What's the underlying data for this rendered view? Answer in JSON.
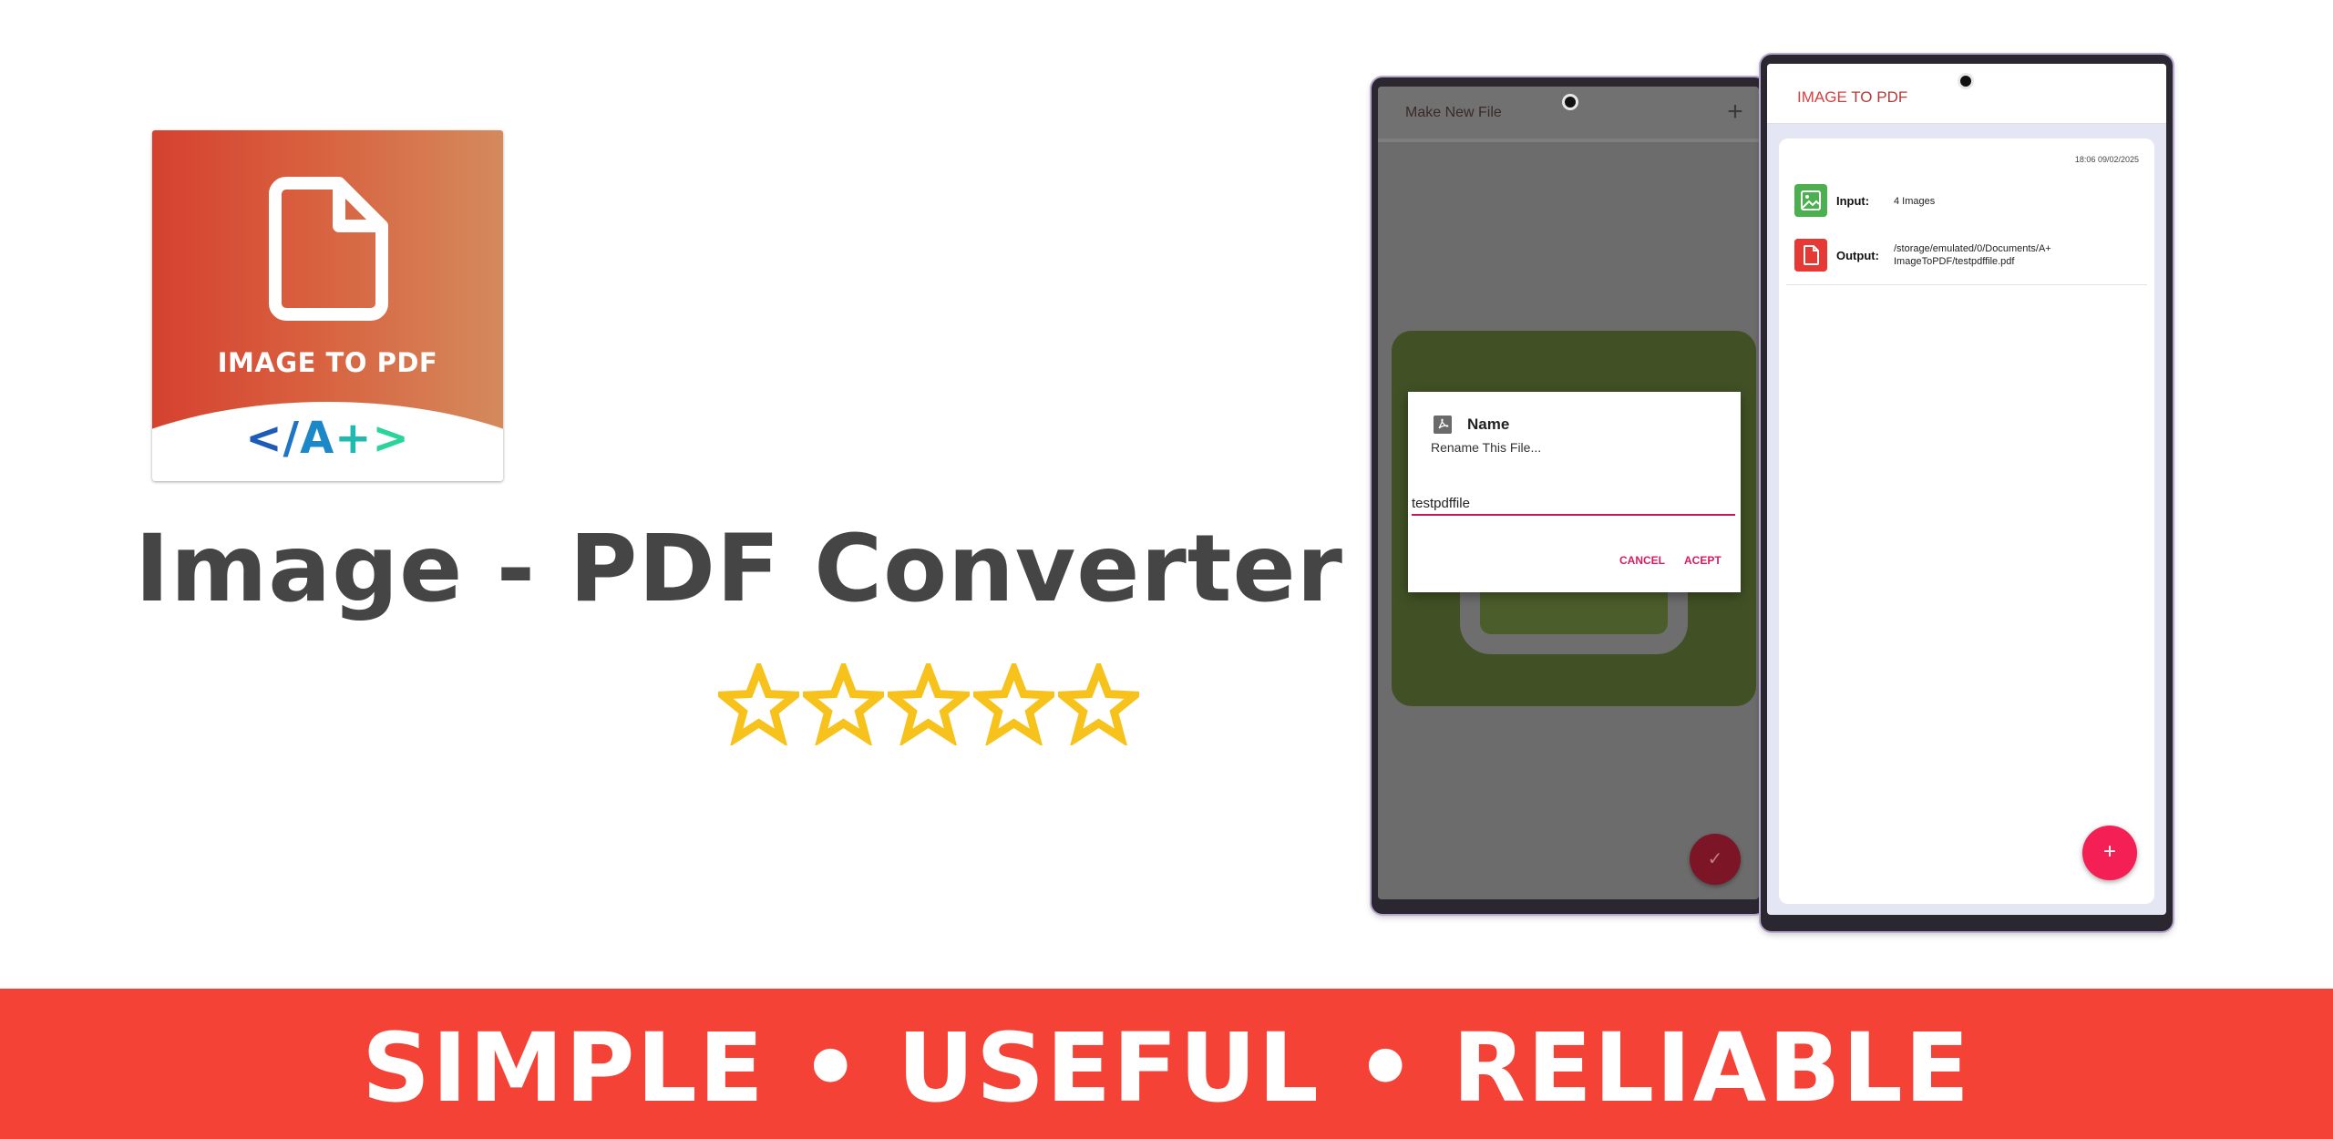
{
  "promo": {
    "icon_title": "IMAGE TO PDF",
    "icon_logo": {
      "lt": "<",
      "slash": "/",
      "a": "A",
      "plus": "+",
      "gt": ">"
    },
    "product_title": "Image - PDF Converter",
    "rating": {
      "stars": 5,
      "max": 5,
      "color": "#f7c21b"
    },
    "tagline": "SIMPLE • USEFUL • RELIABLE",
    "banner_color": "#f44336"
  },
  "left_phone": {
    "appbar_title": "Make New File",
    "add_icon": "+",
    "dialog": {
      "title": "Name",
      "subtitle": "Rename This File...",
      "input_value": "testpdffile",
      "cancel_label": "CANCEL",
      "accept_label": "ACEPT"
    },
    "fab_icon": "✓"
  },
  "right_phone": {
    "appbar_title_part1": "IMAGE",
    "appbar_title_part2": " TO PDF",
    "entry": {
      "timestamp": "18:06 09/02/2025",
      "input_label": "Input:",
      "input_value": "4 Images",
      "output_label": "Output:",
      "output_value": "/storage/emulated/0/Documents/A+ ImageToPDF/testpdffile.pdf"
    },
    "fab_icon": "+"
  },
  "icons": {
    "app_icon": "document-icon",
    "star": "star-icon",
    "pdf": "pdf-icon",
    "image": "image-icon",
    "file": "file-icon"
  }
}
